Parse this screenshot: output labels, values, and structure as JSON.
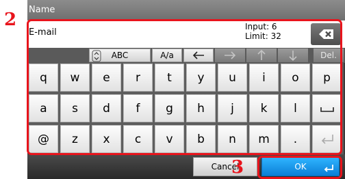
{
  "header": {
    "title": "Name"
  },
  "input": {
    "value": "E-mail",
    "input_label": "Input: 6",
    "limit_label": "Limit: 32"
  },
  "mode_bar": {
    "abc_label": "ABC",
    "case_label": "A/a",
    "del_label": "Del."
  },
  "keyboard": {
    "row1": [
      "q",
      "w",
      "e",
      "r",
      "t",
      "y",
      "u",
      "i",
      "o",
      "p"
    ],
    "row2": [
      "a",
      "s",
      "d",
      "f",
      "g",
      "h",
      "j",
      "k",
      "l"
    ],
    "row3": [
      "@",
      "z",
      "x",
      "c",
      "v",
      "b",
      "n",
      "m",
      "."
    ]
  },
  "footer": {
    "cancel_label": "Cancel",
    "ok_label": "OK"
  },
  "callouts": {
    "step2": "2",
    "step3": "3"
  },
  "colors": {
    "highlight": "#e8141c",
    "ok_button": "#1a9cf0"
  },
  "icons": {
    "clear": "backspace-x-icon",
    "left": "arrow-left-icon",
    "right": "arrow-right-icon",
    "up": "arrow-up-icon",
    "down": "arrow-down-icon",
    "space": "space-icon",
    "enter": "enter-icon",
    "spinner": "up-down-spinner-icon"
  }
}
